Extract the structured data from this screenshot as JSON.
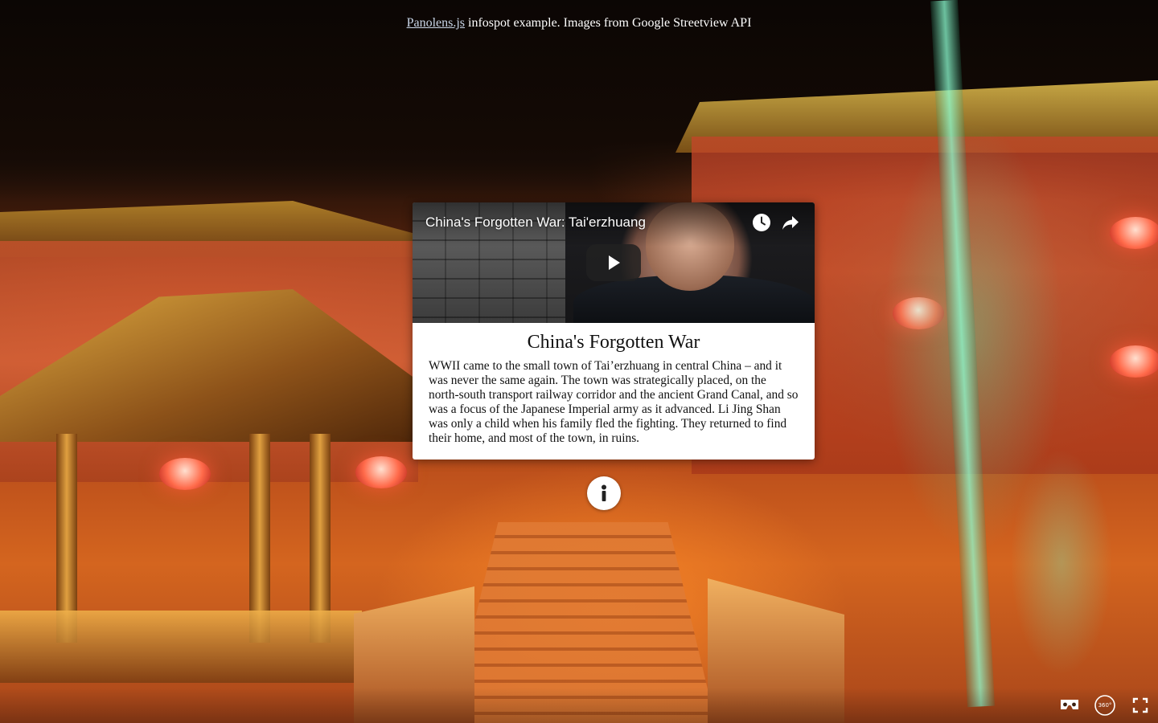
{
  "caption": {
    "link_text": "Panolens.js",
    "text": " infospot example. Images from Google Streetview API"
  },
  "infospot_card": {
    "video": {
      "title": "China's Forgotten War: Tai'erzhuang",
      "watch_later_icon": "clock-icon",
      "share_icon": "share-icon",
      "play_icon": "play-icon"
    },
    "title": "China's Forgotten War",
    "description": "WWII came to the small town of Tai’erzhuang in central China – and it was never the same again. The town was strategically placed, on the north-south transport railway corridor and the ancient Grand Canal, and so was a focus of the Japanese Imperial army as it advanced. Li Jing Shan was only a child when his family fled the fighting. They returned to find their home, and most of the town, in ruins."
  },
  "hotspot": {
    "icon": "info-icon"
  },
  "controls": {
    "cardboard_icon": "cardboard-vr-icon",
    "mode_360_label": "360°",
    "fullscreen_icon": "fullscreen-icon"
  },
  "colors": {
    "card_background": "#ffffff",
    "link": "#c9d6e8",
    "text": "#111111"
  }
}
